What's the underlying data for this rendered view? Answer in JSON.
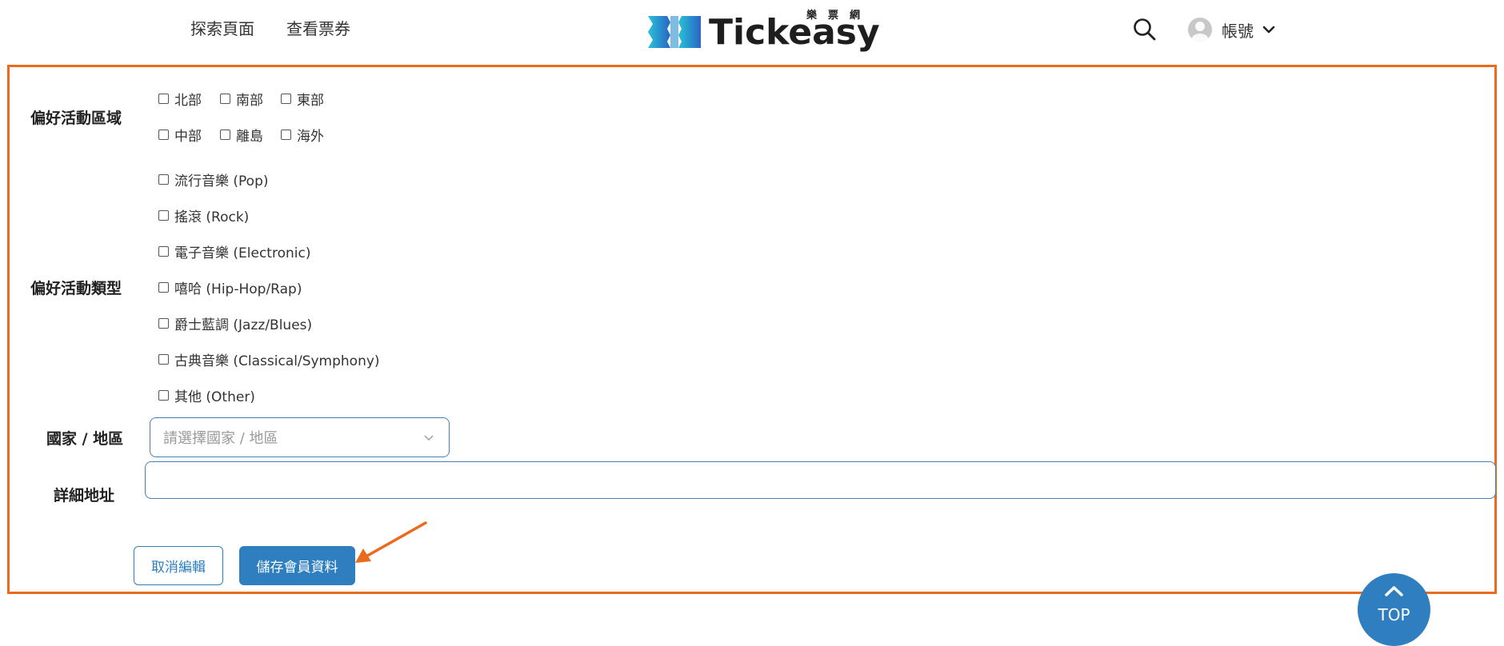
{
  "header": {
    "nav": [
      {
        "label": "探索頁面"
      },
      {
        "label": "查看票券"
      }
    ],
    "logo": {
      "wordmark": "Tickeasy",
      "sub": "樂票網"
    },
    "account_label": "帳號"
  },
  "form": {
    "region": {
      "label": "偏好活動區域",
      "options": [
        "北部",
        "南部",
        "東部",
        "中部",
        "離島",
        "海外"
      ]
    },
    "genre": {
      "label": "偏好活動類型",
      "options": [
        "流行音樂 (Pop)",
        "搖滾 (Rock)",
        "電子音樂 (Electronic)",
        "嘻哈 (Hip-Hop/Rap)",
        "爵士藍調 (Jazz/Blues)",
        "古典音樂 (Classical/Symphony)",
        "其他 (Other)"
      ]
    },
    "country": {
      "label": "國家 / 地區",
      "placeholder": "請選擇國家 / 地區"
    },
    "address": {
      "label": "詳細地址",
      "value": ""
    },
    "buttons": {
      "cancel": "取消編輯",
      "save": "儲存會員資料"
    }
  },
  "top_button": {
    "label": "TOP"
  },
  "colors": {
    "accent": "#2f7fc0",
    "highlight": "#ea6a1e",
    "logo_gradient_start": "#27c3d6",
    "logo_gradient_end": "#2a64c4"
  }
}
